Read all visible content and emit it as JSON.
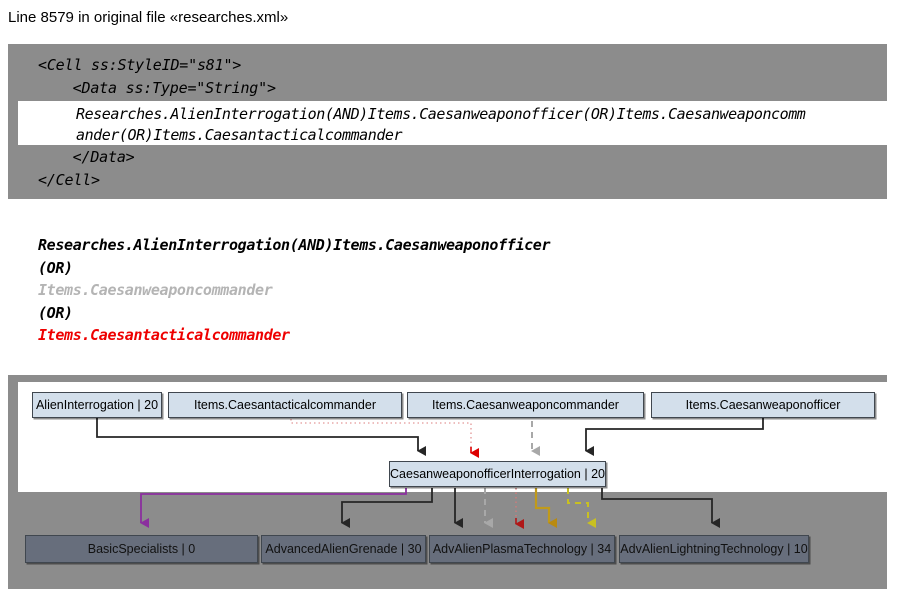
{
  "header": {
    "title": "Line 8579 in original file «researches.xml»"
  },
  "xml_block": {
    "lines": [
      "<Cell ss:StyleID=\"s81\">",
      "  <Data ss:Type=\"String\">",
      "  </Data>",
      "</Cell>"
    ],
    "line_open_cell": "<Cell ss:StyleID=\"s81\">",
    "line_open_data": "  <Data ss:Type=\"String\">",
    "line_close_data": "  </Data>",
    "line_close_cell": "</Cell>",
    "highlight": {
      "line1": "Researches.AlienInterrogation(AND)Items.Caesanweaponofficer(OR)Items.Caesanweaponcomm",
      "line2": "ander(OR)Items.Caesantacticalcommander"
    },
    "background_color": "#8c8c8c",
    "highlight_background": "#ffffff"
  },
  "expression": {
    "lines": [
      {
        "text": "Researches.AlienInterrogation(AND)Items.Caesanweaponofficer",
        "color": "#000000",
        "style": "normal"
      },
      {
        "text": "(OR)",
        "color": "#000000",
        "style": "normal"
      },
      {
        "text": "Items.Caesanweaponcommander",
        "color": "#b4b4b4",
        "style": "muted"
      },
      {
        "text": "(OR)",
        "color": "#000000",
        "style": "normal"
      },
      {
        "text": "Items.Caesantacticalcommander",
        "color": "#ee0000",
        "style": "red"
      }
    ]
  },
  "graph": {
    "background_color": "#8c8c8c",
    "panel_color": "#ffffff",
    "top_nodes": [
      {
        "label": "AlienInterrogation | 20"
      },
      {
        "label": "Items.Caesantacticalcommander"
      },
      {
        "label": "Items.Caesanweaponcommander"
      },
      {
        "label": "Items.Caesanweaponofficer"
      }
    ],
    "center_node": {
      "label": "CaesanweaponofficerInterrogation | 20"
    },
    "bottom_nodes": [
      {
        "label": "BasicSpecialists | 0"
      },
      {
        "label": "AdvancedAlienGrenade | 30"
      },
      {
        "label": "AdvAlienPlasmaTechnology | 34"
      },
      {
        "label": "AdvAlienLightningTechnology | 10"
      }
    ],
    "edge_colors": {
      "solid_black": "#262626",
      "dotted_red_pale": "#e8a9a9",
      "arrow_red": "#dd0000",
      "dashed_gray": "#a8a8a8",
      "purple": "#8b2f9e",
      "olive_solid": "#c09a1a",
      "olive_dashed": "#c8c021",
      "dotted_rose": "#c97e7e"
    }
  }
}
